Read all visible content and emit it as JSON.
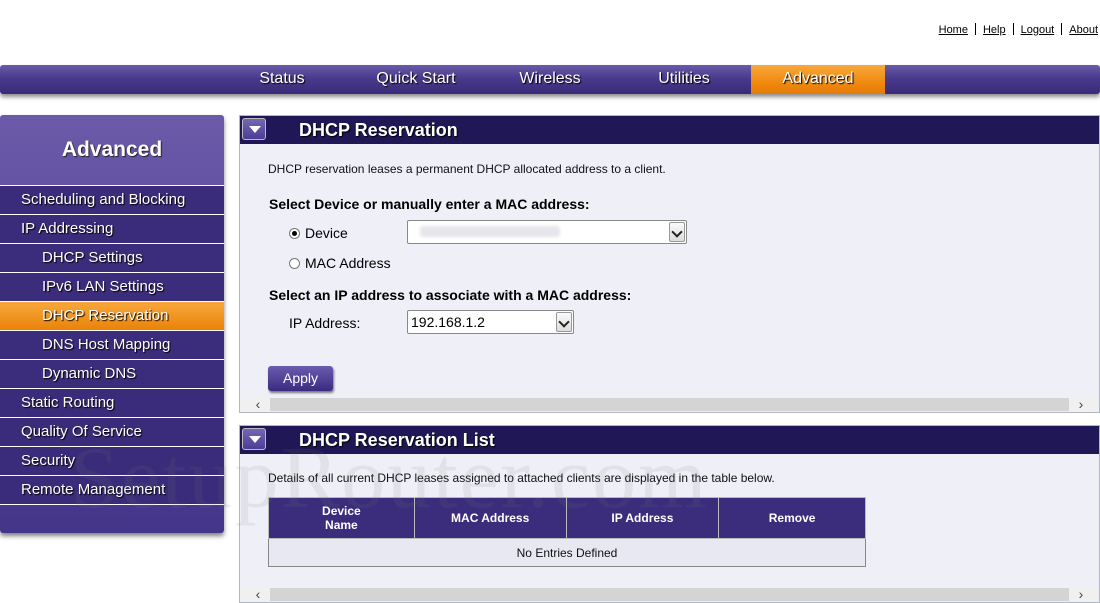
{
  "top_links": [
    "Home",
    "Help",
    "Logout",
    "About"
  ],
  "nav": {
    "tabs": [
      "Status",
      "Quick Start",
      "Wireless",
      "Utilities",
      "Advanced"
    ],
    "active": "Advanced"
  },
  "sidebar": {
    "title": "Advanced",
    "items": [
      {
        "label": "Scheduling and Blocking"
      },
      {
        "label": "IP Addressing"
      },
      {
        "label": "DHCP Settings"
      },
      {
        "label": "IPv6 LAN Settings"
      },
      {
        "label": "DHCP Reservation"
      },
      {
        "label": "DNS Host Mapping"
      },
      {
        "label": "Dynamic DNS"
      },
      {
        "label": "Static Routing"
      },
      {
        "label": "Quality Of Service"
      },
      {
        "label": "Security"
      },
      {
        "label": "Remote Management"
      }
    ]
  },
  "reservation": {
    "title": "DHCP Reservation",
    "description": "DHCP reservation leases a permanent DHCP allocated address to a client.",
    "select_device_label": "Select Device or manually enter a MAC address:",
    "device_option": "Device",
    "mac_option": "MAC Address",
    "selected_option": "Device",
    "select_ip_label": "Select an IP address to associate with a MAC address:",
    "ip_label": "IP Address:",
    "ip_value": "192.168.1.2",
    "apply_label": "Apply"
  },
  "reservation_list": {
    "title": "DHCP Reservation List",
    "description": "Details of all current DHCP leases assigned to attached clients are displayed in the table below.",
    "columns": [
      "Device Name",
      "MAC Address",
      "IP Address",
      "Remove"
    ],
    "empty_text": "No Entries Defined"
  },
  "watermark": "SetupRouter.com",
  "colors": {
    "nav_purple": "#4a3a8c",
    "panel_header": "#1f1756",
    "active_orange": "#f08a10"
  }
}
